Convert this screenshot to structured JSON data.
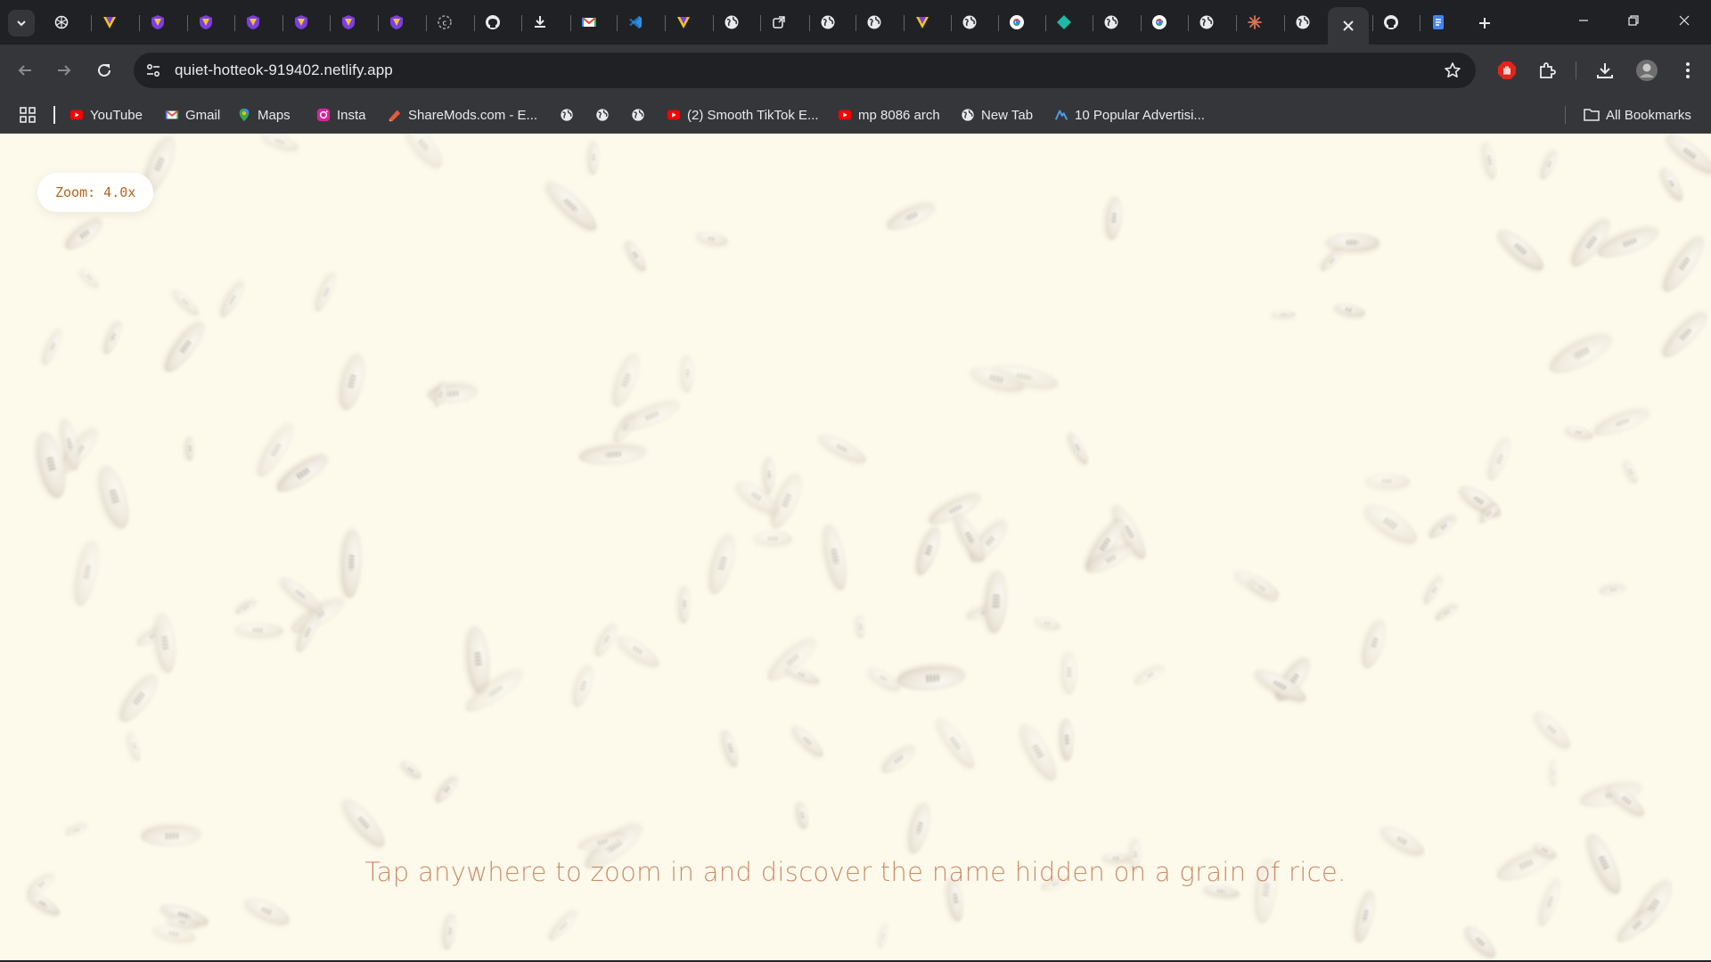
{
  "browser": {
    "tabs": [
      {
        "icon": "openai-icon"
      },
      {
        "icon": "vercel-v-icon"
      },
      {
        "icon": "shield-v-icon"
      },
      {
        "icon": "shield-v-icon"
      },
      {
        "icon": "shield-v-icon"
      },
      {
        "icon": "shield-v-icon"
      },
      {
        "icon": "shield-v-icon"
      },
      {
        "icon": "shield-v-icon"
      },
      {
        "icon": "circle-c-icon"
      },
      {
        "icon": "github-icon"
      },
      {
        "icon": "download-icon"
      },
      {
        "icon": "gmail-icon"
      },
      {
        "icon": "vscode-icon"
      },
      {
        "icon": "vercel-v-icon"
      },
      {
        "icon": "globe-icon"
      },
      {
        "icon": "external-link-icon"
      },
      {
        "icon": "globe-icon"
      },
      {
        "icon": "globe-icon"
      },
      {
        "icon": "vercel-v-icon"
      },
      {
        "icon": "globe-icon"
      },
      {
        "icon": "google-icon"
      },
      {
        "icon": "diamond-icon"
      },
      {
        "icon": "globe-icon"
      },
      {
        "icon": "google-icon"
      },
      {
        "icon": "globe-icon"
      },
      {
        "icon": "claude-icon"
      },
      {
        "icon": "globe-icon"
      },
      {
        "icon": "close-icon",
        "active": true
      },
      {
        "icon": "github-icon"
      },
      {
        "icon": "docs-icon"
      }
    ],
    "address_bar": {
      "url": "quiet-hotteok-919402.netlify.app"
    },
    "bookmarks": [
      {
        "label": "YouTube",
        "icon": "youtube-icon"
      },
      {
        "label": "Gmail",
        "icon": "gmail-icon"
      },
      {
        "label": "Maps",
        "icon": "maps-icon"
      },
      {
        "label": "Insta",
        "icon": "instagram-icon"
      },
      {
        "label": "ShareMods.com - E...",
        "icon": "sharemods-icon"
      },
      {
        "label": "",
        "icon": "globe-icon"
      },
      {
        "label": "",
        "icon": "globe-icon"
      },
      {
        "label": "",
        "icon": "globe-icon"
      },
      {
        "label": "(2) Smooth TikTok E...",
        "icon": "youtube-icon"
      },
      {
        "label": "mp 8086 arch",
        "icon": "youtube-icon"
      },
      {
        "label": "New Tab",
        "icon": "globe-icon"
      },
      {
        "label": "10 Popular Advertisi...",
        "icon": "ai-logo-icon"
      }
    ],
    "all_bookmarks_label": "All Bookmarks"
  },
  "page": {
    "zoom_label": "Zoom: 4.0x",
    "hint": "Tap anywhere to zoom in and discover the name hidden on a grain of rice.",
    "background_color": "#fdfaec",
    "hint_color": "#c47a54",
    "zoom_color": "#b5651d"
  }
}
